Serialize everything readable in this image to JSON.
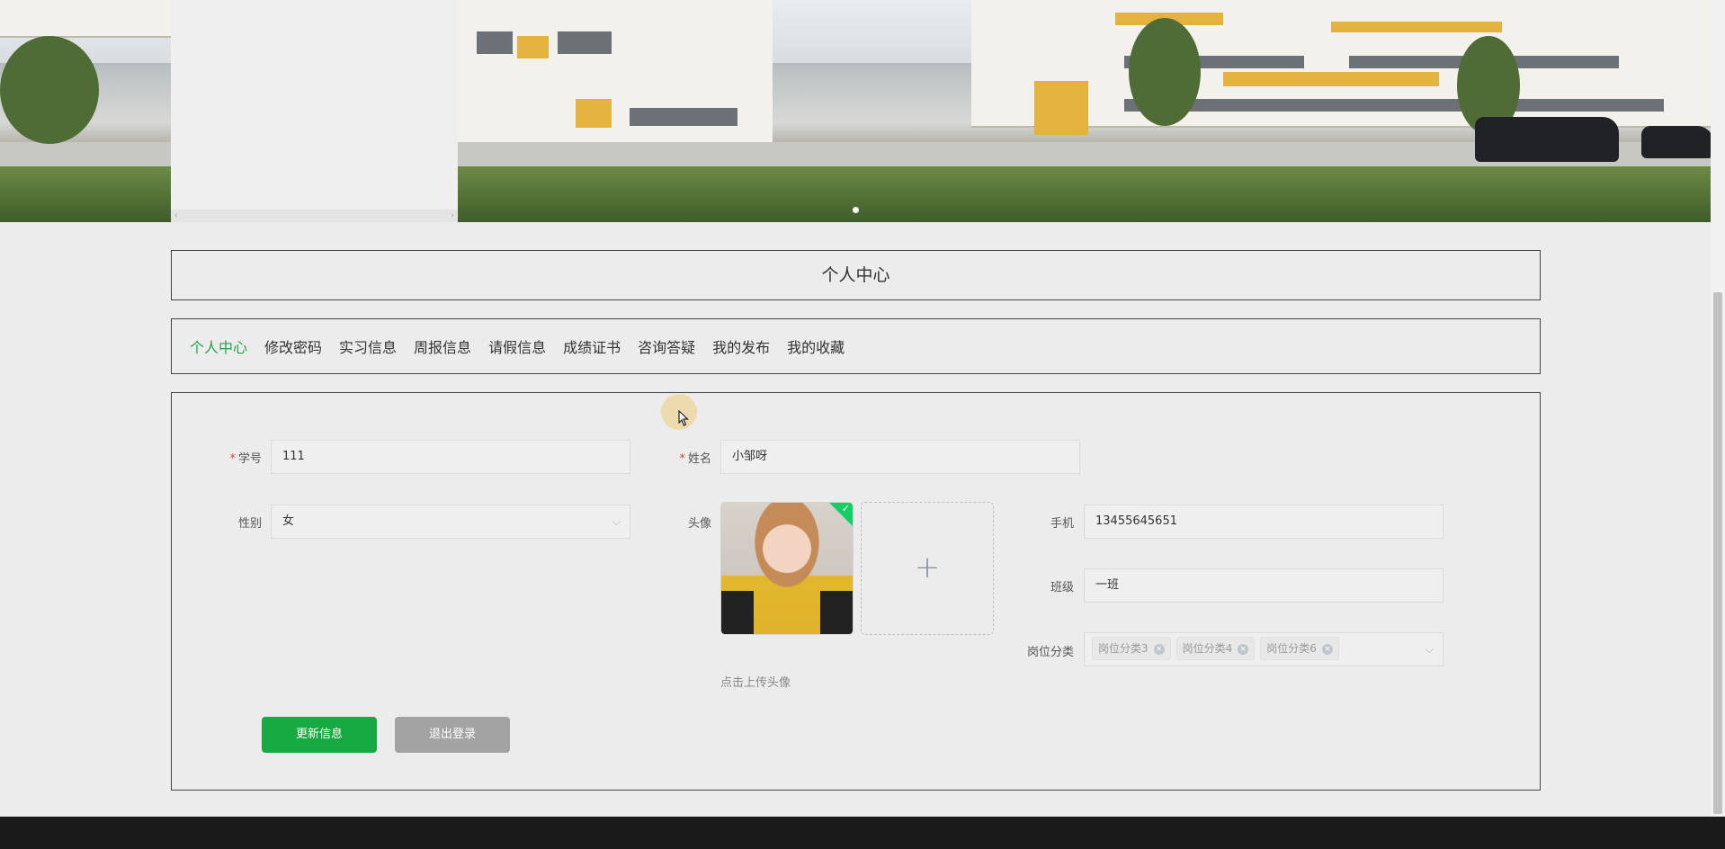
{
  "banner": {
    "side_panel": {
      "scroll_left": "‹",
      "scroll_right": "›"
    },
    "carousel_indicator": "1"
  },
  "page_title": "个人中心",
  "nav": {
    "items": [
      {
        "label": "个人中心",
        "active": true
      },
      {
        "label": "修改密码",
        "active": false
      },
      {
        "label": "实习信息",
        "active": false
      },
      {
        "label": "周报信息",
        "active": false
      },
      {
        "label": "请假信息",
        "active": false
      },
      {
        "label": "成绩证书",
        "active": false
      },
      {
        "label": "咨询答疑",
        "active": false
      },
      {
        "label": "我的发布",
        "active": false
      },
      {
        "label": "我的收藏",
        "active": false
      }
    ]
  },
  "form": {
    "student_id": {
      "label": "学号",
      "required": "*",
      "value": "111"
    },
    "name": {
      "label": "姓名",
      "required": "*",
      "value": "小邹呀"
    },
    "gender": {
      "label": "性别",
      "value": "女",
      "caret": "⌵"
    },
    "avatar": {
      "label": "头像",
      "upload_tip": "点击上传头像",
      "upload_plus": "+",
      "check": "✓"
    },
    "phone": {
      "label": "手机",
      "value": "13455645651"
    },
    "class": {
      "label": "班级",
      "value": "一班"
    },
    "position": {
      "label": "岗位分类",
      "tags": [
        "岗位分类3",
        "岗位分类4",
        "岗位分类6"
      ],
      "tag_close": "×",
      "caret": "⌵"
    }
  },
  "buttons": {
    "update": "更新信息",
    "logout": "退出登录"
  },
  "colors": {
    "accent": "#17a942",
    "nav_active": "#22a34a",
    "logout": "#a3a3a3",
    "required": "#e04646"
  },
  "icons": {
    "plus": "plus-icon",
    "check": "check-icon",
    "chevron": "chevron-down-icon",
    "cursor": "mouse-cursor-icon"
  }
}
